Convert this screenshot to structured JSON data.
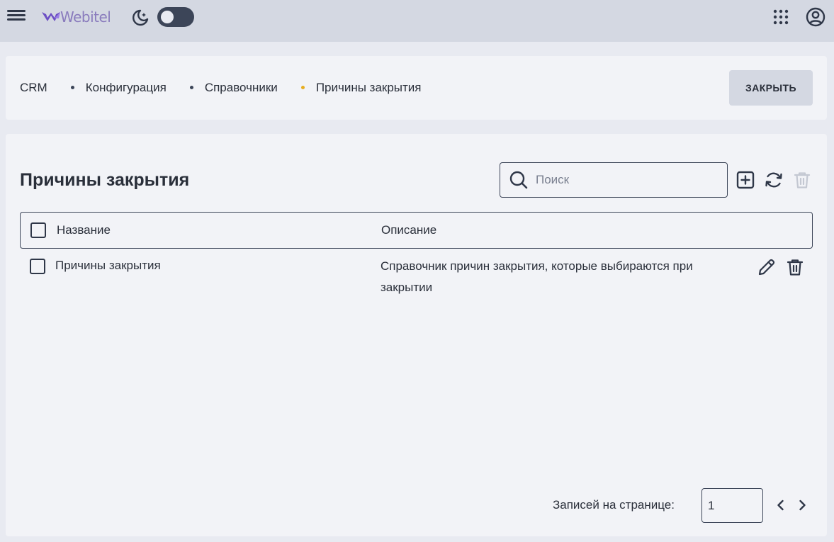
{
  "header": {
    "logo_text": "Webitel",
    "brand_color": "#8a7cbd",
    "icons": [
      "menu-icon",
      "moon-icon",
      "apps-grid-icon",
      "account-icon"
    ]
  },
  "breadcrumbs": [
    {
      "label": "CRM"
    },
    {
      "label": "Конфигурация"
    },
    {
      "label": "Справочники"
    },
    {
      "label": "Причины закрытия"
    }
  ],
  "close_button_label": "ЗАКРЫТЬ",
  "page_title": "Причины закрытия",
  "search": {
    "placeholder": "Поиск",
    "value": ""
  },
  "table": {
    "columns": [
      "Название",
      "Описание"
    ],
    "rows": [
      {
        "name": "Причины закрытия",
        "description": "Справочник причин закрытия, которые выбираются при закрытии"
      }
    ]
  },
  "pagination": {
    "label": "Записей на странице:",
    "value": "1"
  },
  "colors": {
    "active_crumb_dot": "#e7ad20",
    "header_bg": "#d4d8e2",
    "card_bg": "#f2f3f7"
  }
}
